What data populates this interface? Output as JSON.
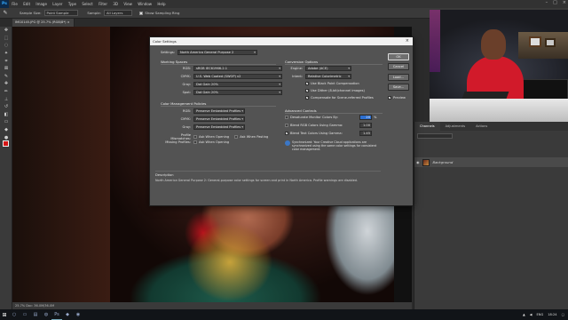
{
  "menubar": {
    "logo": "Ps",
    "items": [
      "File",
      "Edit",
      "Image",
      "Layer",
      "Type",
      "Select",
      "Filter",
      "3D",
      "View",
      "Window",
      "Help"
    ]
  },
  "optionsbar": {
    "sample_size_label": "Sample Size:",
    "sample_size_value": "Point Sample",
    "sample_label": "Sample:",
    "sample_value": "All Layers",
    "show_ring_label": "Show Sampling Ring"
  },
  "doc_tab": "IMG0145.JPG @ 25.7% (RGB/8*) ×",
  "statusbar": "25.7%    Doc: 36.0M/36.0M",
  "dialog": {
    "title": "Color Settings",
    "settings_label": "Settings:",
    "settings_value": "North America General Purpose 2",
    "working_spaces": {
      "heading": "Working Spaces",
      "rows": [
        {
          "label": "RGB:",
          "value": "sRGB IEC61966-2.1"
        },
        {
          "label": "CMYK:",
          "value": "U.S. Web Coated (SWOP) v2"
        },
        {
          "label": "Gray:",
          "value": "Dot Gain 20%"
        },
        {
          "label": "Spot:",
          "value": "Dot Gain 20%"
        }
      ]
    },
    "policies": {
      "heading": "Color Management Policies",
      "rows": [
        {
          "label": "RGB:",
          "value": "Preserve Embedded Profiles"
        },
        {
          "label": "CMYK:",
          "value": "Preserve Embedded Profiles"
        },
        {
          "label": "Gray:",
          "value": "Preserve Embedded Profiles"
        }
      ],
      "mismatches_label": "Profile Mismatches:",
      "ask_opening": "Ask When Opening",
      "ask_pasting": "Ask When Pasting",
      "missing_label": "Missing Profiles:",
      "missing_ask_opening": "Ask When Opening"
    },
    "conversion": {
      "heading": "Conversion Options",
      "engine_label": "Engine:",
      "engine_value": "Adobe (ACE)",
      "intent_label": "Intent:",
      "intent_value": "Relative Colorimetric",
      "bpc": "Use Black Point Compensation",
      "dither": "Use Dither (8-bit/channel images)",
      "compensate": "Compensate for Scene-referred Profiles"
    },
    "advanced": {
      "heading": "Advanced Controls",
      "desaturate": "Desaturate Monitor Colors By:",
      "desaturate_value": "20",
      "desaturate_unit": "%",
      "blend_rgb": "Blend RGB Colors Using Gamma:",
      "blend_rgb_value": "1.00",
      "blend_text": "Blend Text Colors Using Gamma:",
      "blend_text_value": "1.45"
    },
    "sync_text": "Synchronized: Your Creative Cloud applications are synchronized using the same color settings for consistent color management.",
    "description_heading": "Description",
    "description_text": "North America General Purpose 2:  General-purpose color settings for screen and print in North America. Profile warnings are disabled.",
    "buttons": {
      "ok": "OK",
      "cancel": "Cancel",
      "load": "Load...",
      "save": "Save...",
      "preview": "Preview"
    }
  },
  "panel": {
    "tabs": [
      "Channels",
      "Adjustments",
      "Actions"
    ],
    "layer_name": "Background"
  },
  "taskbar": {
    "lang": "ENG",
    "time": "18:24"
  },
  "colors": {
    "accent": "#2d6fd0",
    "fg_swatch": "#d61616",
    "dialog_bg": "#535353"
  }
}
